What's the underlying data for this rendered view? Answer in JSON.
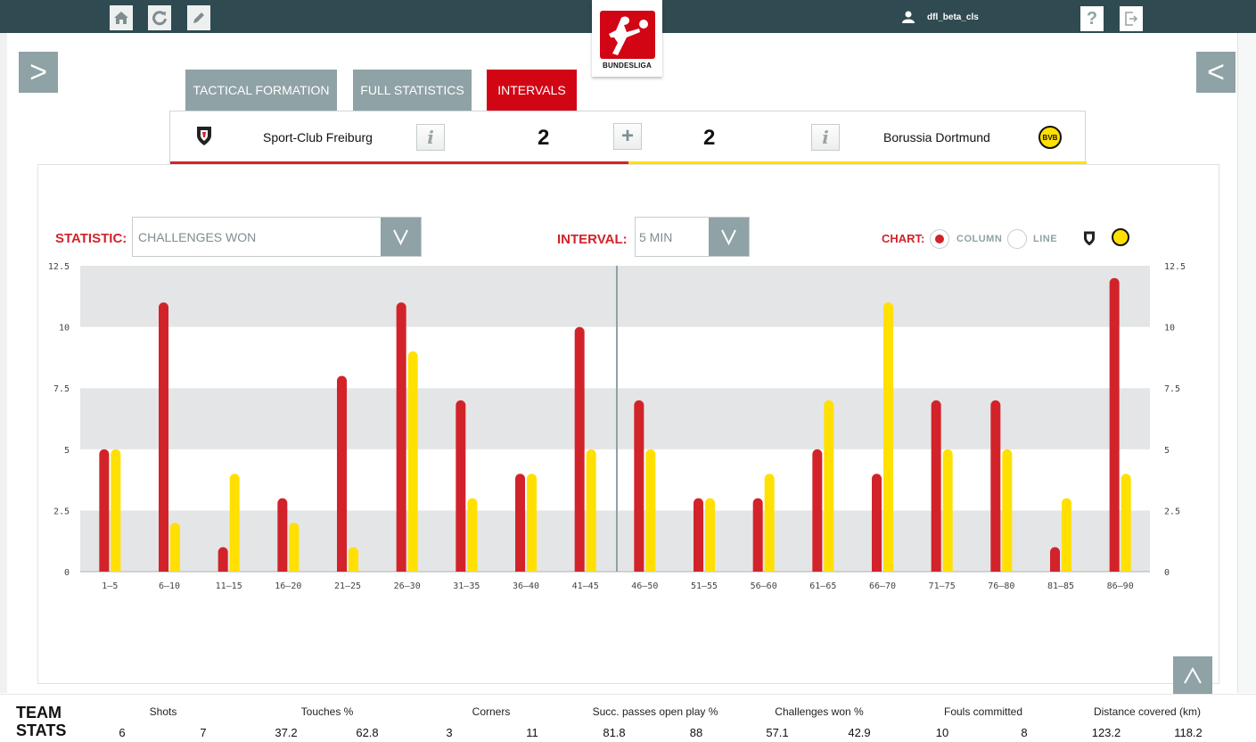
{
  "topbar": {
    "user": "dfl_beta_cls",
    "logo_text": "BUNDESLIGA",
    "help_label": "?"
  },
  "nav": {
    "open_left": ">",
    "open_right": "<"
  },
  "tabs": [
    {
      "label": "TACTICAL FORMATION",
      "active": false
    },
    {
      "label": "FULL STATISTICS",
      "active": false
    },
    {
      "label": "INTERVALS",
      "active": true
    }
  ],
  "match": {
    "home_team": "Sport-Club Freiburg",
    "away_team": "Borussia Dortmund",
    "home_score": "2",
    "away_score": "2",
    "away_badge": "BVB"
  },
  "controls": {
    "statistic_label": "STATISTIC:",
    "statistic_value": "CHALLENGES WON",
    "interval_label": "INTERVAL:",
    "interval_value": "5 MIN",
    "chart_label": "CHART:",
    "chart_options": [
      "COLUMN",
      "LINE"
    ],
    "chart_selected": "COLUMN"
  },
  "colors": {
    "home": "#d2232a",
    "away": "#ffe000",
    "accent": "#8fa2a5",
    "topbar": "#2f4a51"
  },
  "chart_data": {
    "type": "bar",
    "categories": [
      "1–5",
      "6–10",
      "11–15",
      "16–20",
      "21–25",
      "26–30",
      "31–35",
      "36–40",
      "41–45",
      "46–50",
      "51–55",
      "56–60",
      "61–65",
      "66–70",
      "71–75",
      "76–80",
      "81–85",
      "86–90"
    ],
    "series": [
      {
        "values": [
          5,
          11,
          1,
          3,
          8,
          11,
          7,
          4,
          10,
          7,
          3,
          3,
          5,
          4,
          7,
          7,
          1,
          12
        ]
      },
      {
        "values": [
          5,
          2,
          4,
          2,
          1,
          9,
          3,
          4,
          5,
          5,
          3,
          4,
          7,
          11,
          5,
          5,
          3,
          4
        ]
      }
    ],
    "y_ticks": [
      "0",
      "2.5",
      "5",
      "7.5",
      "10",
      "12.5"
    ],
    "ylim": [
      0,
      12.5
    ],
    "halftime_after": "41–45",
    "grid": "alternating bands"
  },
  "team_stats": {
    "title_line1": "TEAM",
    "title_line2": "STATS",
    "items": [
      {
        "name": "Shots",
        "home": "6",
        "away": "7"
      },
      {
        "name": "Touches %",
        "home": "37.2",
        "away": "62.8"
      },
      {
        "name": "Corners",
        "home": "3",
        "away": "11"
      },
      {
        "name": "Succ. passes open play %",
        "home": "81.8",
        "away": "88"
      },
      {
        "name": "Challenges won %",
        "home": "57.1",
        "away": "42.9"
      },
      {
        "name": "Fouls committed",
        "home": "10",
        "away": "8"
      },
      {
        "name": "Distance covered (km)",
        "home": "123.2",
        "away": "118.2"
      }
    ]
  }
}
